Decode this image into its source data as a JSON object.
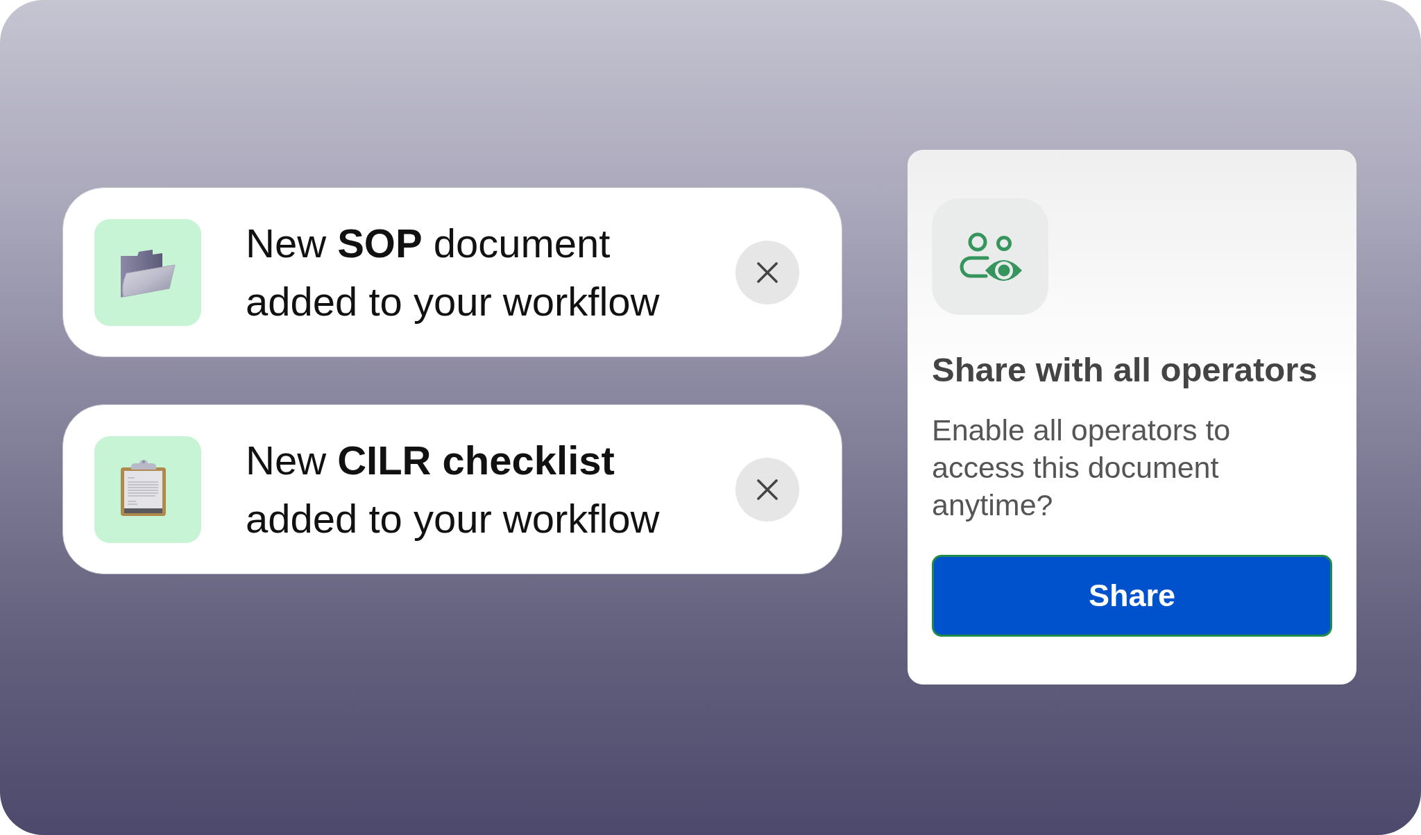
{
  "notifications": [
    {
      "kind": "folder",
      "message": "New **SOP** document added to your workflow"
    },
    {
      "kind": "clipboard",
      "message": "New **CILR checklist** added to your workflow"
    }
  ],
  "share_card": {
    "title": "Share with all operators",
    "description": "Enable all operators to access this document anytime?",
    "button": "Share"
  }
}
